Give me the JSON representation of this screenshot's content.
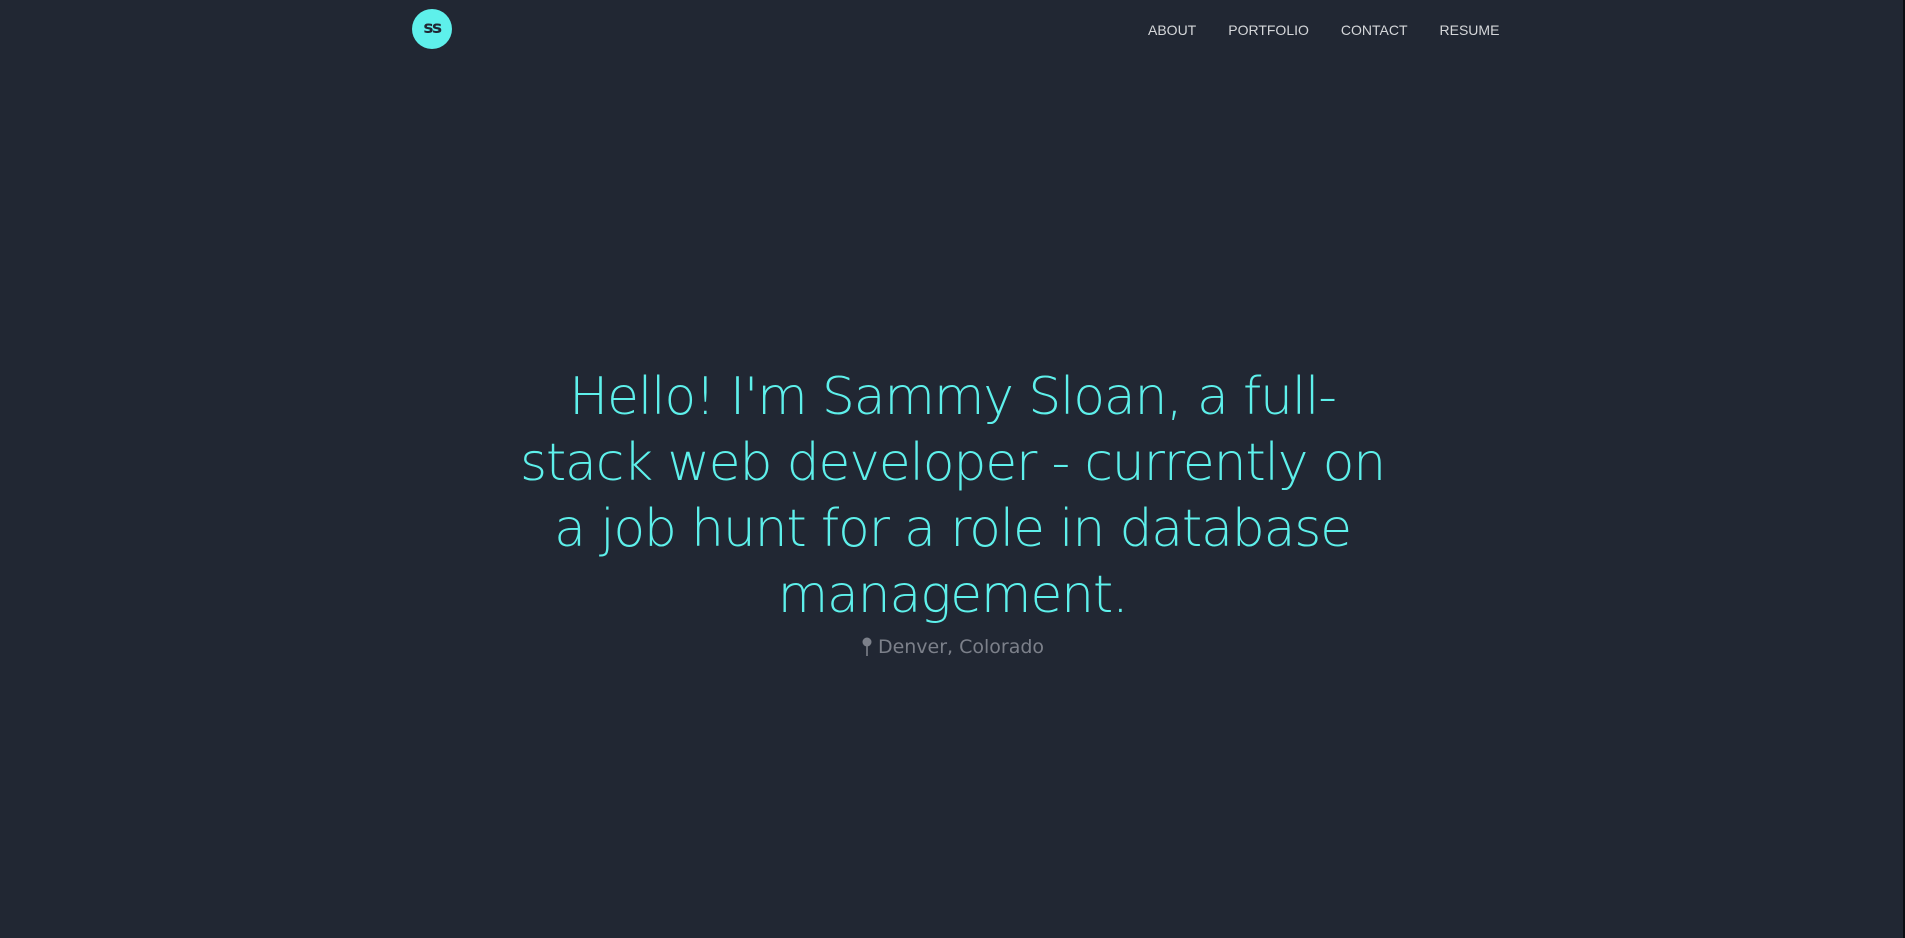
{
  "logo": {
    "text": "ss"
  },
  "nav": {
    "items": [
      {
        "label": "ABOUT"
      },
      {
        "label": "PORTFOLIO"
      },
      {
        "label": "CONTACT"
      },
      {
        "label": "RESUME"
      }
    ]
  },
  "hero": {
    "headline": "Hello! I'm Sammy Sloan, a full-stack web developer - currently on a job hunt for a role in database management.",
    "location": "Denver, Colorado",
    "location_icon": "pin-icon"
  },
  "colors": {
    "background": "#212733",
    "accent": "#5ef0eb",
    "nav_text": "#d5d7da",
    "muted_text": "#7c808a"
  }
}
